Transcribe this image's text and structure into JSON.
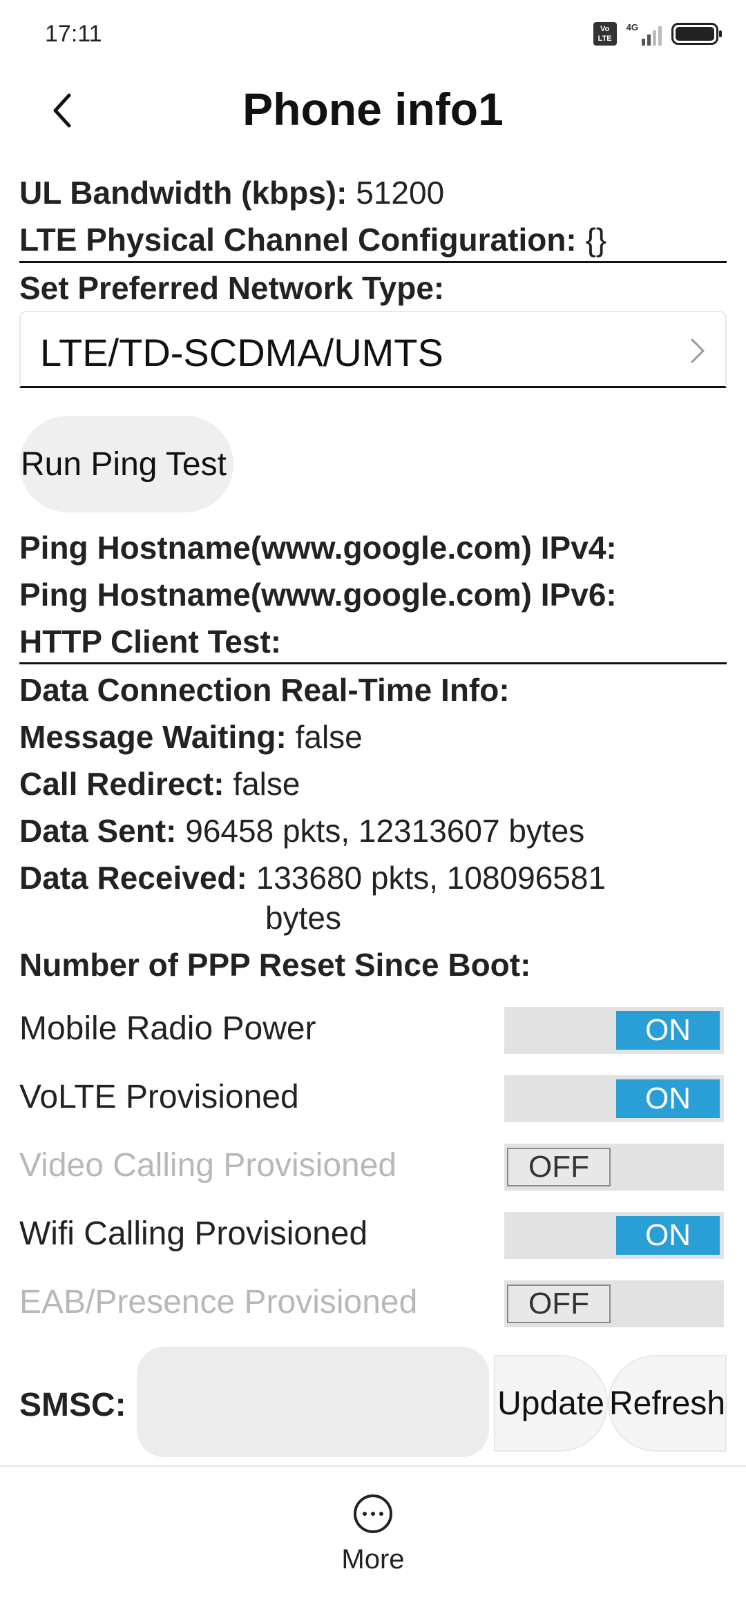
{
  "status_bar": {
    "time": "17:11",
    "network": "4G",
    "volte_badge_top": "Vo",
    "volte_badge_bottom": "LTE",
    "icons": [
      "volte-icon",
      "signal-icon",
      "battery-icon"
    ]
  },
  "header": {
    "title": "Phone info1",
    "back_icon": "chevron-left-icon"
  },
  "info_top": [
    {
      "label": "UL Bandwidth (kbps):",
      "value": "51200"
    },
    {
      "label": "LTE Physical Channel Configuration:",
      "value": "{}"
    }
  ],
  "preferred_network": {
    "label": "Set Preferred Network Type:",
    "value": "LTE/TD-SCDMA/UMTS",
    "arrow_icon": "chevron-right-icon"
  },
  "ping": {
    "button_label": "Run Ping Test",
    "ipv4_label": "Ping Hostname(www.google.com) IPv4:",
    "ipv4_value": "",
    "ipv6_label": "Ping Hostname(www.google.com) IPv6:",
    "ipv6_value": "",
    "http_label": "HTTP Client Test:",
    "http_value": ""
  },
  "data_info": {
    "realtime_label": "Data Connection Real-Time Info:",
    "message_waiting_label": "Message Waiting:",
    "message_waiting_value": "false",
    "call_redirect_label": "Call Redirect:",
    "call_redirect_value": "false",
    "data_sent_label": "Data Sent:",
    "data_sent_value": "96458 pkts, 12313607 bytes",
    "data_received_label": "Data Received:",
    "data_received_value_line1": "133680 pkts, 108096581",
    "data_received_value_line2": "bytes",
    "ppp_reset_label": "Number of PPP Reset Since Boot:",
    "ppp_reset_value": ""
  },
  "toggles": [
    {
      "label": "Mobile Radio Power",
      "state": "ON",
      "on": true,
      "enabled": true
    },
    {
      "label": "VoLTE Provisioned",
      "state": "ON",
      "on": true,
      "enabled": true
    },
    {
      "label": "Video Calling Provisioned",
      "state": "OFF",
      "on": false,
      "enabled": false
    },
    {
      "label": "Wifi Calling Provisioned",
      "state": "ON",
      "on": true,
      "enabled": true
    },
    {
      "label": "EAB/Presence Provisioned",
      "state": "OFF",
      "on": false,
      "enabled": false
    }
  ],
  "smsc": {
    "label": "SMSC:",
    "value": "",
    "update_label": "Update",
    "refresh_label": "Refresh"
  },
  "bottom_bar": {
    "more_label": "More",
    "more_icon": "more-icon"
  },
  "colors": {
    "toggle_on": "#2a9fd6",
    "toggle_track": "#e2e2e2",
    "disabled_text": "#b8b8b8"
  }
}
